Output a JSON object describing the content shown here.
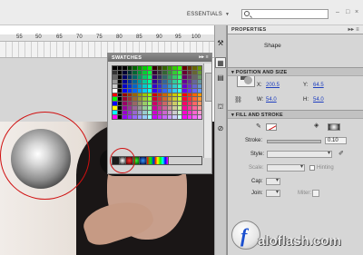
{
  "topbar": {
    "workspace_label": "ESSENTIALS",
    "search_placeholder": "",
    "window_controls": [
      "–",
      "□",
      "×"
    ]
  },
  "ruler": {
    "ticks": [
      "55",
      "50",
      "65",
      "70",
      "75",
      "80",
      "85",
      "90",
      "95",
      "100"
    ]
  },
  "swatches": {
    "title": "SWATCHES",
    "header_controls": "▸▸ ≡"
  },
  "properties": {
    "title": "PROPERTIES",
    "header_controls": "▸▸ ≡",
    "object_type": "Shape",
    "position_size": {
      "title": "POSITION AND SIZE",
      "x_label": "X:",
      "x": "200.5",
      "y_label": "Y:",
      "y": "64.5",
      "w_label": "W:",
      "w": "54.0",
      "h_label": "H:",
      "h": "54.0"
    },
    "fill_stroke": {
      "title": "FILL AND STROKE",
      "stroke_label": "Stroke:",
      "stroke_value": "0.10",
      "style_label": "Style:",
      "scale_label": "Scale:",
      "hinting_label": "Hinting",
      "cap_label": "Cap:",
      "join_label": "Join:",
      "miter_label": "Miter:"
    }
  },
  "watermark": {
    "logo_letter": "f",
    "text": "aloflash.com"
  },
  "colors": {
    "panel": "#d6d6d6",
    "header_dark": "#6c6c6c",
    "link_blue": "#1f3fbf",
    "annotation_red": "#d01010"
  },
  "icons": [
    "search-icon",
    "tool-icon",
    "grid-icon",
    "library-icon",
    "compass-icon",
    "pencil-icon",
    "paint-bucket-icon",
    "lock-icon",
    "eyedropper-icon"
  ]
}
